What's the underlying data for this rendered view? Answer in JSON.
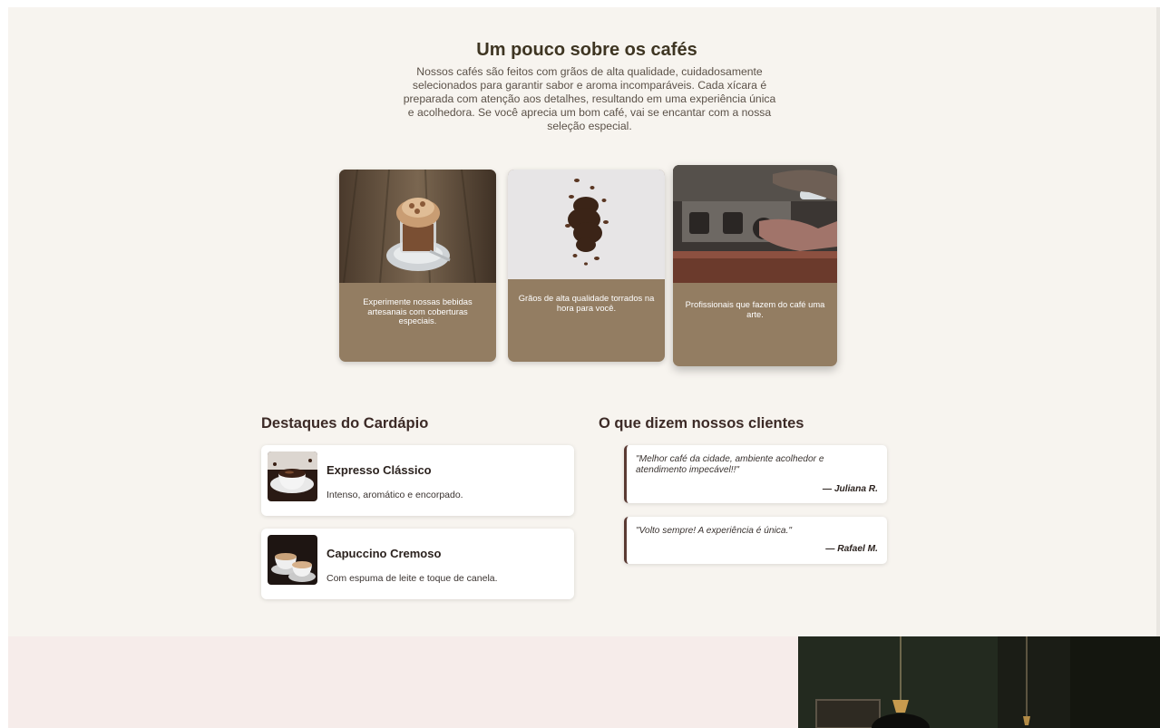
{
  "about": {
    "title": "Um pouco sobre os cafés",
    "text": "Nossos cafés são feitos com grãos de alta qualidade, cuidadosamente selecionados para garantir sabor e aroma incomparáveis. Cada xícara é preparada com atenção aos detalhes, resultando em uma experiência única e acolhedora. Se você aprecia um bom café, vai se encantar com a nossa seleção especial."
  },
  "features": [
    {
      "caption": "Experimente nossas bebidas artesanais com coberturas especiais.",
      "image": "iced-coffee-photo"
    },
    {
      "caption": "Grãos de alta qualidade torrados na hora para você.",
      "image": "coffee-beans-photo"
    },
    {
      "caption": "Profissionais que fazem do café uma arte.",
      "image": "barista-espresso-machine-photo"
    }
  ],
  "menu": {
    "title": "Destaques do Cardápio",
    "items": [
      {
        "name": "Expresso Clássico",
        "description": "Intenso, aromático e encorpado.",
        "image": "espresso-cup-photo"
      },
      {
        "name": "Capuccino Cremoso",
        "description": "Com espuma de leite e toque de canela.",
        "image": "cappuccino-cups-photo"
      }
    ]
  },
  "testimonials": {
    "title": "O que dizem nossos clientes",
    "items": [
      {
        "quote": "\"Melhor café da cidade, ambiente acolhedor e atendimento impecável!!\"",
        "author": "— Juliana R."
      },
      {
        "quote": "\"Volto sempre! A experiência é única.\"",
        "author": "— Rafael M."
      }
    ]
  },
  "colors": {
    "page_bg": "#f7f4ef",
    "card_bg": "#937d62",
    "heading": "#3e3522",
    "testimonial_accent": "#5a3a33",
    "bottom_band": "#f6ecea"
  }
}
